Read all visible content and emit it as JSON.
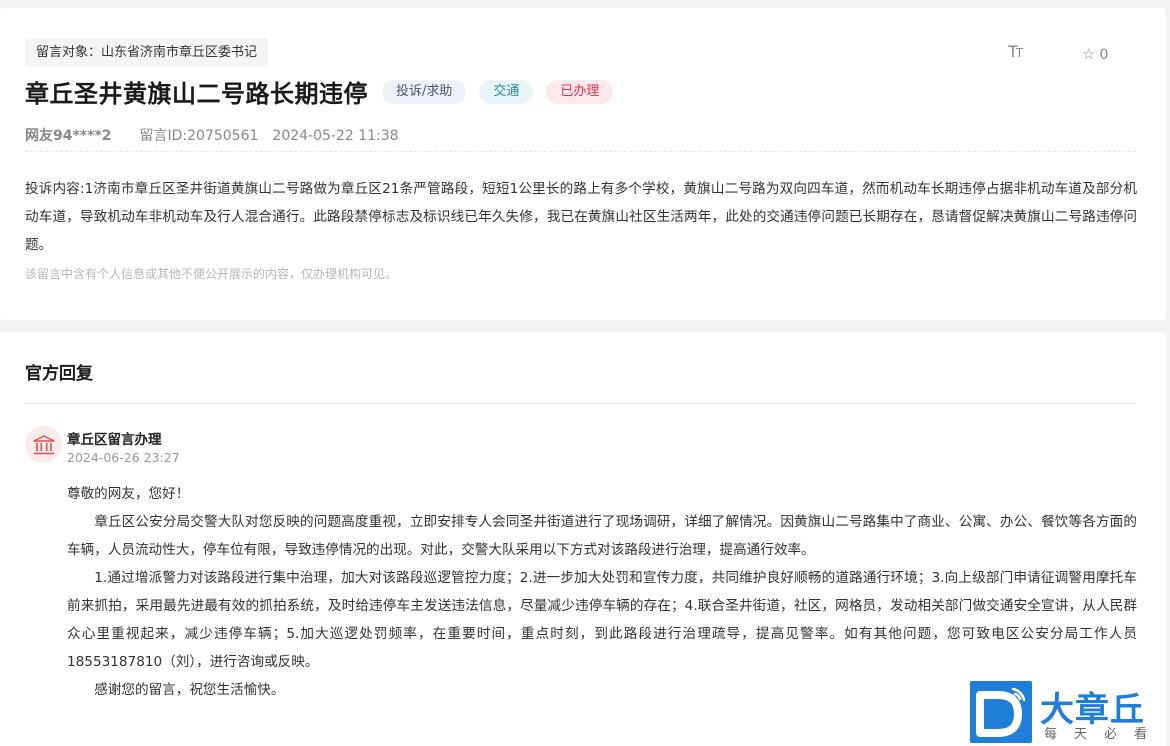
{
  "message": {
    "target_label": "留言对象：山东省济南市章丘区委书记",
    "font_size_icon": "font-size-icon",
    "favorite_count": "0",
    "title": "章丘圣井黄旗山二号路长期违停",
    "tags": {
      "type": "投诉/求助",
      "category": "交通",
      "status": "已办理"
    },
    "tag_colors": {
      "type_bg": "#eef1f7",
      "category_bg": "#e8f6f9",
      "status_bg": "#fde9ec",
      "status_text": "#e0314f"
    },
    "author": "网友94****2",
    "message_id": "留言ID:20750561",
    "datetime": "2024-05-22 11:38",
    "content": "投诉内容:1济南市章丘区圣井街道黄旗山二号路做为章丘区21条严管路段，短短1公里长的路上有多个学校，黄旗山二号路为双向四车道，然而机动车长期违停占据非机动车道及部分机动车道，导致机动车非机动车及行人混合通行。此路段禁停标志及标识线已年久失修，我已在黄旗山社区生活两年，此处的交通违停问题已长期存在，恳请督促解决黄旗山二号路违停问题。",
    "privacy_notice": "该留言中含有个人信息或其他不便公开展示的内容，仅办理机构可见。"
  },
  "reply": {
    "heading": "官方回复",
    "avatar_icon": "government-building-icon",
    "department": "章丘区留言办理",
    "datetime": "2024-06-26 23:27",
    "greeting": "尊敬的网友，您好！",
    "paragraph_1": "章丘区公安分局交警大队对您反映的问题高度重视，立即安排专人会同圣井街道进行了现场调研，详细了解情况。因黄旗山二号路集中了商业、公寓、办公、餐饮等各方面的车辆，人员流动性大，停车位有限，导致违停情况的出现。对此，交警大队采用以下方式对该路段进行治理，提高通行效率。",
    "paragraph_2": "1.通过增派警力对该路段进行集中治理，加大对该路段巡逻管控力度；2.进一步加大处罚和宣传力度，共同维护良好顺畅的道路通行环境；3.向上级部门申请征调警用摩托车前来抓拍，采用最先进最有效的抓拍系统，及时给违停车主发送违法信息，尽量减少违停车辆的存在；4.联合圣井街道，社区，网格员，发动相关部门做交通安全宣讲，从人民群众心里重视起来，减少违停车辆；5.加大巡逻处罚频率，在重要时间，重点时刻，到此路段进行治理疏导，提高见警率。如有其他问题，您可致电区公安分局工作人员18553187810（刘），进行咨询或反映。",
    "closing": "感谢您的留言，祝您生活愉快。"
  },
  "watermark": {
    "logo_icon": "d-logo-icon",
    "name": "大章丘",
    "slogan": "每天必看",
    "color": "#1f7fd8"
  }
}
